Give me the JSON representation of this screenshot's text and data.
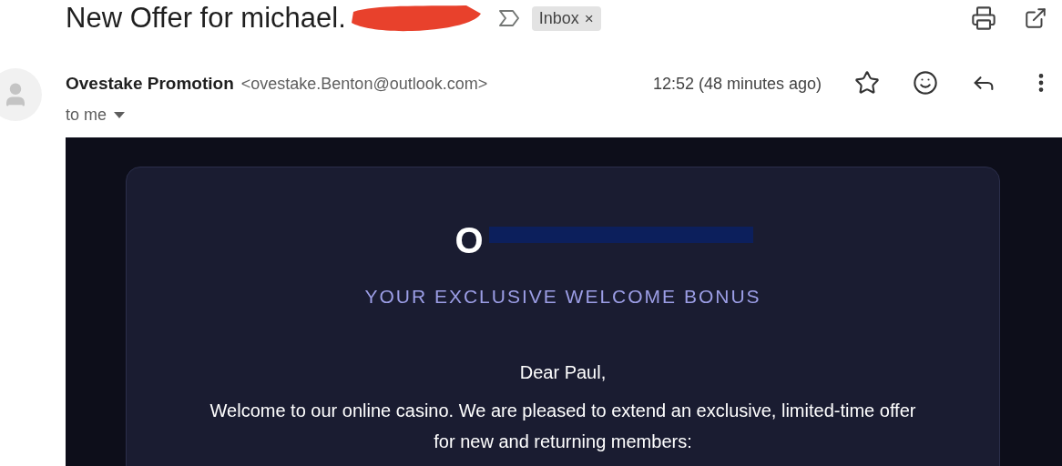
{
  "subject": "New Offer for michael.",
  "label": {
    "text": "Inbox",
    "remove": "×"
  },
  "sender": {
    "name": "Ovestake Promotion",
    "email": "<ovestake.Benton@outlook.com>",
    "recipient": "to me"
  },
  "time": "12:52 (48 minutes ago)",
  "email_body": {
    "logo": "O",
    "tagline": "YOUR EXCLUSIVE WELCOME BONUS",
    "greeting": "Dear Paul,",
    "paragraph": "Welcome to our online casino. We are pleased to extend an exclusive, limited-time offer for new and returning members:"
  }
}
